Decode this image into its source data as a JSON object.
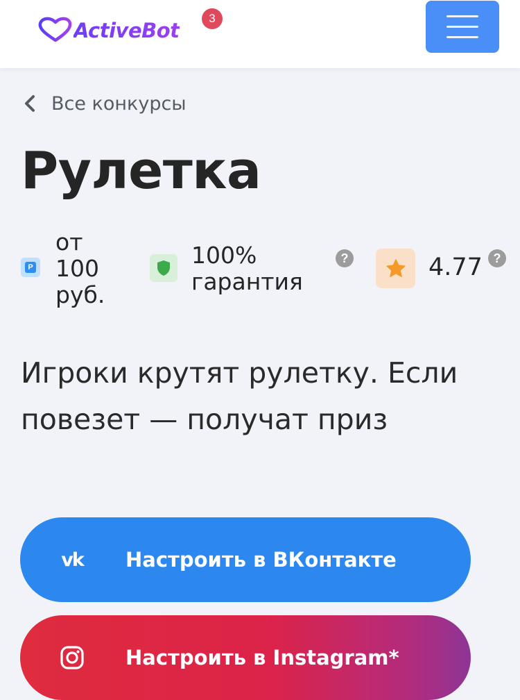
{
  "header": {
    "logo_text": "ActiveBot",
    "logo_icon": "heart-speed-icon",
    "notification_count": "3",
    "menu_icon": "hamburger-icon"
  },
  "breadcrumb": {
    "back_label": "Все конкурсы"
  },
  "page": {
    "title": "Рулетка",
    "description": "Игроки крутят рулетку. Если повезет — получат приз"
  },
  "stats": {
    "price_currency_glyph": "Р",
    "price_label": "от 100 руб.",
    "guarantee_label": "100% гарантия",
    "rating_value": "4.77",
    "help_glyph": "?"
  },
  "actions": {
    "vk_label": "Настроить в ВКонтакте",
    "vk_icon_glyph": "vk",
    "instagram_label": "Настроить в Instagram*"
  },
  "colors": {
    "accent_blue": "#4a8ff7",
    "vk_blue": "#2c88ef",
    "badge_red": "#e0485c",
    "logo_purple": "#7b3ff2",
    "background": "#f1f3f9"
  }
}
